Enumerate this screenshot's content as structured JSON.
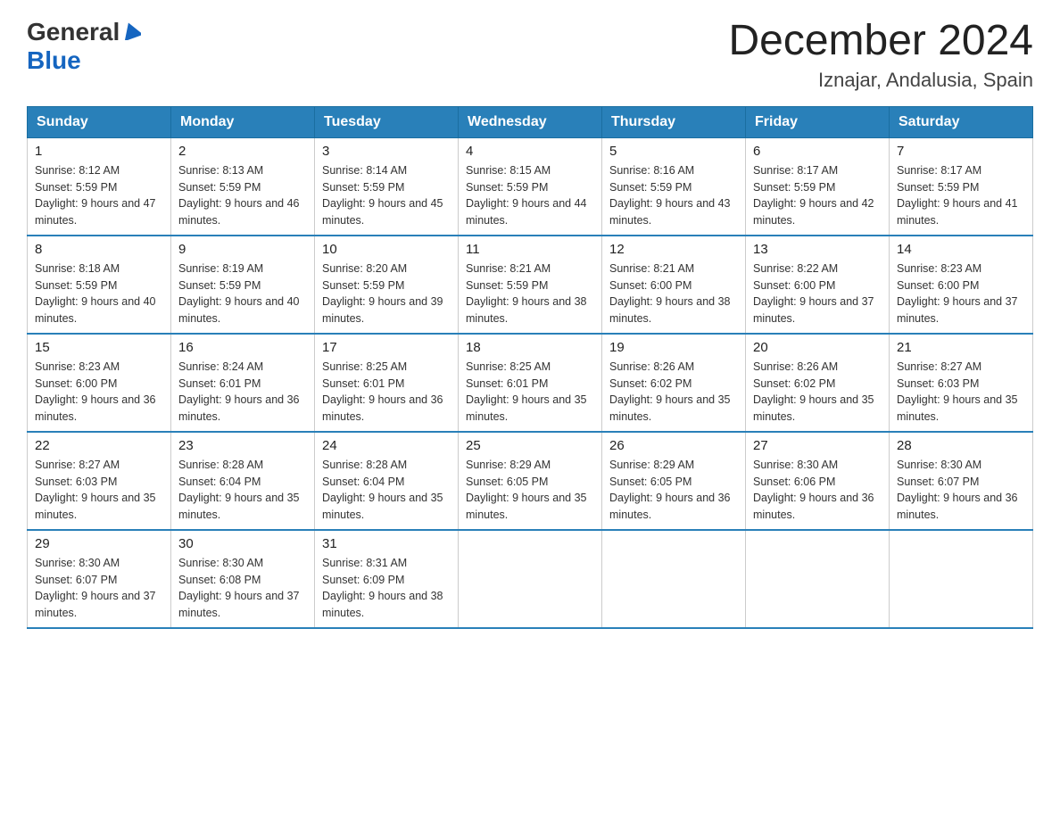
{
  "header": {
    "logo_general": "General",
    "logo_blue": "Blue",
    "month_title": "December 2024",
    "location": "Iznajar, Andalusia, Spain"
  },
  "days_of_week": [
    "Sunday",
    "Monday",
    "Tuesday",
    "Wednesday",
    "Thursday",
    "Friday",
    "Saturday"
  ],
  "weeks": [
    [
      {
        "day": "1",
        "sunrise": "8:12 AM",
        "sunset": "5:59 PM",
        "daylight": "9 hours and 47 minutes."
      },
      {
        "day": "2",
        "sunrise": "8:13 AM",
        "sunset": "5:59 PM",
        "daylight": "9 hours and 46 minutes."
      },
      {
        "day": "3",
        "sunrise": "8:14 AM",
        "sunset": "5:59 PM",
        "daylight": "9 hours and 45 minutes."
      },
      {
        "day": "4",
        "sunrise": "8:15 AM",
        "sunset": "5:59 PM",
        "daylight": "9 hours and 44 minutes."
      },
      {
        "day": "5",
        "sunrise": "8:16 AM",
        "sunset": "5:59 PM",
        "daylight": "9 hours and 43 minutes."
      },
      {
        "day": "6",
        "sunrise": "8:17 AM",
        "sunset": "5:59 PM",
        "daylight": "9 hours and 42 minutes."
      },
      {
        "day": "7",
        "sunrise": "8:17 AM",
        "sunset": "5:59 PM",
        "daylight": "9 hours and 41 minutes."
      }
    ],
    [
      {
        "day": "8",
        "sunrise": "8:18 AM",
        "sunset": "5:59 PM",
        "daylight": "9 hours and 40 minutes."
      },
      {
        "day": "9",
        "sunrise": "8:19 AM",
        "sunset": "5:59 PM",
        "daylight": "9 hours and 40 minutes."
      },
      {
        "day": "10",
        "sunrise": "8:20 AM",
        "sunset": "5:59 PM",
        "daylight": "9 hours and 39 minutes."
      },
      {
        "day": "11",
        "sunrise": "8:21 AM",
        "sunset": "5:59 PM",
        "daylight": "9 hours and 38 minutes."
      },
      {
        "day": "12",
        "sunrise": "8:21 AM",
        "sunset": "6:00 PM",
        "daylight": "9 hours and 38 minutes."
      },
      {
        "day": "13",
        "sunrise": "8:22 AM",
        "sunset": "6:00 PM",
        "daylight": "9 hours and 37 minutes."
      },
      {
        "day": "14",
        "sunrise": "8:23 AM",
        "sunset": "6:00 PM",
        "daylight": "9 hours and 37 minutes."
      }
    ],
    [
      {
        "day": "15",
        "sunrise": "8:23 AM",
        "sunset": "6:00 PM",
        "daylight": "9 hours and 36 minutes."
      },
      {
        "day": "16",
        "sunrise": "8:24 AM",
        "sunset": "6:01 PM",
        "daylight": "9 hours and 36 minutes."
      },
      {
        "day": "17",
        "sunrise": "8:25 AM",
        "sunset": "6:01 PM",
        "daylight": "9 hours and 36 minutes."
      },
      {
        "day": "18",
        "sunrise": "8:25 AM",
        "sunset": "6:01 PM",
        "daylight": "9 hours and 35 minutes."
      },
      {
        "day": "19",
        "sunrise": "8:26 AM",
        "sunset": "6:02 PM",
        "daylight": "9 hours and 35 minutes."
      },
      {
        "day": "20",
        "sunrise": "8:26 AM",
        "sunset": "6:02 PM",
        "daylight": "9 hours and 35 minutes."
      },
      {
        "day": "21",
        "sunrise": "8:27 AM",
        "sunset": "6:03 PM",
        "daylight": "9 hours and 35 minutes."
      }
    ],
    [
      {
        "day": "22",
        "sunrise": "8:27 AM",
        "sunset": "6:03 PM",
        "daylight": "9 hours and 35 minutes."
      },
      {
        "day": "23",
        "sunrise": "8:28 AM",
        "sunset": "6:04 PM",
        "daylight": "9 hours and 35 minutes."
      },
      {
        "day": "24",
        "sunrise": "8:28 AM",
        "sunset": "6:04 PM",
        "daylight": "9 hours and 35 minutes."
      },
      {
        "day": "25",
        "sunrise": "8:29 AM",
        "sunset": "6:05 PM",
        "daylight": "9 hours and 35 minutes."
      },
      {
        "day": "26",
        "sunrise": "8:29 AM",
        "sunset": "6:05 PM",
        "daylight": "9 hours and 36 minutes."
      },
      {
        "day": "27",
        "sunrise": "8:30 AM",
        "sunset": "6:06 PM",
        "daylight": "9 hours and 36 minutes."
      },
      {
        "day": "28",
        "sunrise": "8:30 AM",
        "sunset": "6:07 PM",
        "daylight": "9 hours and 36 minutes."
      }
    ],
    [
      {
        "day": "29",
        "sunrise": "8:30 AM",
        "sunset": "6:07 PM",
        "daylight": "9 hours and 37 minutes."
      },
      {
        "day": "30",
        "sunrise": "8:30 AM",
        "sunset": "6:08 PM",
        "daylight": "9 hours and 37 minutes."
      },
      {
        "day": "31",
        "sunrise": "8:31 AM",
        "sunset": "6:09 PM",
        "daylight": "9 hours and 38 minutes."
      },
      null,
      null,
      null,
      null
    ]
  ]
}
